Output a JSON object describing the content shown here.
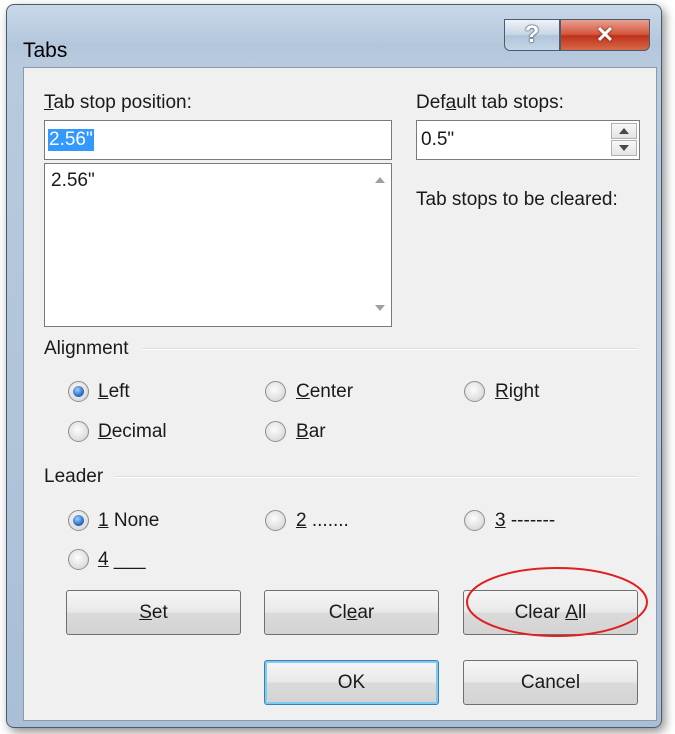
{
  "window": {
    "title": "Tabs",
    "help_glyph": "?",
    "close_glyph": "✕"
  },
  "tab_stop": {
    "label_pre": "",
    "label_mnemonic": "T",
    "label_post": "ab stop position:",
    "value": "2.56\"",
    "list": [
      "2.56\""
    ]
  },
  "default_tab": {
    "label_pre": "Def",
    "label_mnemonic": "a",
    "label_post": "ult tab stops:",
    "value": "0.5\""
  },
  "to_be_cleared_label": "Tab stops to be cleared:",
  "alignment": {
    "label": "Alignment",
    "options": [
      {
        "mnemonic": "L",
        "rest": "eft",
        "selected": true
      },
      {
        "mnemonic": "C",
        "rest": "enter",
        "selected": false
      },
      {
        "mnemonic": "R",
        "rest": "ight",
        "selected": false
      },
      {
        "mnemonic": "D",
        "rest": "ecimal",
        "selected": false
      },
      {
        "mnemonic": "B",
        "rest": "ar",
        "selected": false
      }
    ]
  },
  "leader": {
    "label": "Leader",
    "options": [
      {
        "mnemonic": "1",
        "rest": " None",
        "selected": true
      },
      {
        "mnemonic": "2",
        "rest": " .......",
        "selected": false
      },
      {
        "mnemonic": "3",
        "rest": " -------",
        "selected": false
      },
      {
        "mnemonic": "4",
        "rest": " ___",
        "selected": false
      }
    ]
  },
  "buttons": {
    "set": {
      "pre": "",
      "mnemonic": "S",
      "post": "et"
    },
    "clear": {
      "pre": "Cl",
      "mnemonic": "e",
      "post": "ar"
    },
    "clear_all": {
      "pre": "Clear ",
      "mnemonic": "A",
      "post": "ll"
    },
    "ok": "OK",
    "cancel": "Cancel"
  },
  "colors": {
    "annotation_circle": "#e02020",
    "selection": "#3399ff"
  }
}
